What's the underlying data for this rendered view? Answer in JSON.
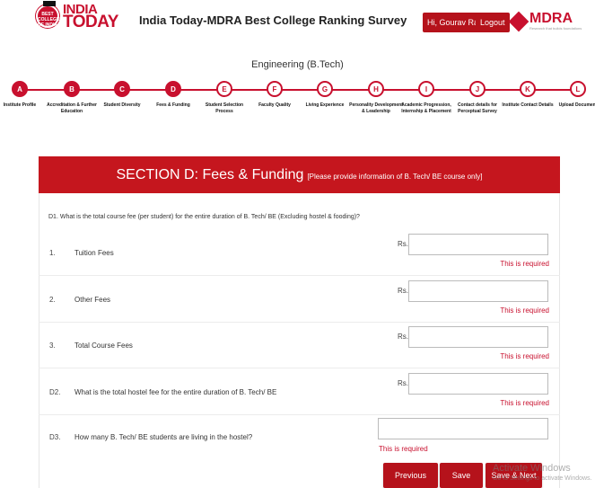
{
  "header": {
    "logo_lines": [
      "INDIA",
      "TODAY"
    ],
    "logo_seal": "BEST COLLEGES OF INDIA",
    "title": "India Today-MDRA Best College Ranking Survey",
    "user_greeting": "Hi, Gourav Raj",
    "logout_label": "Logout",
    "partner_logo": "MDRA",
    "partner_sub": "Research that builds foundations"
  },
  "stream": "Engineering (B.Tech)",
  "steps": [
    {
      "letter": "A",
      "label": "Institute Profile",
      "done": true
    },
    {
      "letter": "B",
      "label": "Accreditation & Further Education",
      "done": true
    },
    {
      "letter": "C",
      "label": "Student Diversity",
      "done": true
    },
    {
      "letter": "D",
      "label": "Fees & Funding",
      "done": true
    },
    {
      "letter": "E",
      "label": "Student Selection Process",
      "done": false
    },
    {
      "letter": "F",
      "label": "Faculty Quality",
      "done": false
    },
    {
      "letter": "G",
      "label": "Living Experience",
      "done": false
    },
    {
      "letter": "H",
      "label": "Personality Development & Leadership",
      "done": false
    },
    {
      "letter": "I",
      "label": "Academic Progression, Internship & Placement",
      "done": false
    },
    {
      "letter": "J",
      "label": "Contact details for Perceptual Survey",
      "done": false
    },
    {
      "letter": "K",
      "label": "Institute Contact Details",
      "done": false
    },
    {
      "letter": "L",
      "label": "Upload Document",
      "done": false
    }
  ],
  "section": {
    "title": "SECTION D: Fees & Funding",
    "note": "[Please provide information of B. Tech/ BE course only]"
  },
  "q1_text": "D1. What is the total course fee (per student) for the entire duration of B. Tech/ BE (Excluding hostel & fooding)?",
  "rows": [
    {
      "num": "1.",
      "text": "Tuition Fees",
      "prefix": "Rs.",
      "value": "",
      "error": "This is required"
    },
    {
      "num": "2.",
      "text": "Other Fees",
      "prefix": "Rs.",
      "value": "",
      "error": "This is required"
    },
    {
      "num": "3.",
      "text": "Total Course Fees",
      "prefix": "Rs.",
      "value": "",
      "error": "This is required"
    },
    {
      "num": "D2.",
      "text": "What is the total hostel fee for the entire duration of B. Tech/ BE",
      "prefix": "Rs.",
      "value": "",
      "error": "This is required"
    },
    {
      "num": "D3.",
      "text": "How many B. Tech/ BE students are living in the hostel?",
      "prefix": "",
      "value": "",
      "error": "This is required"
    }
  ],
  "buttons": {
    "previous": "Previous",
    "save": "Save",
    "save_next": "Save & Next"
  },
  "watermark": {
    "line1": "Activate Windows",
    "line2": "Go to Settings to activate Windows."
  }
}
